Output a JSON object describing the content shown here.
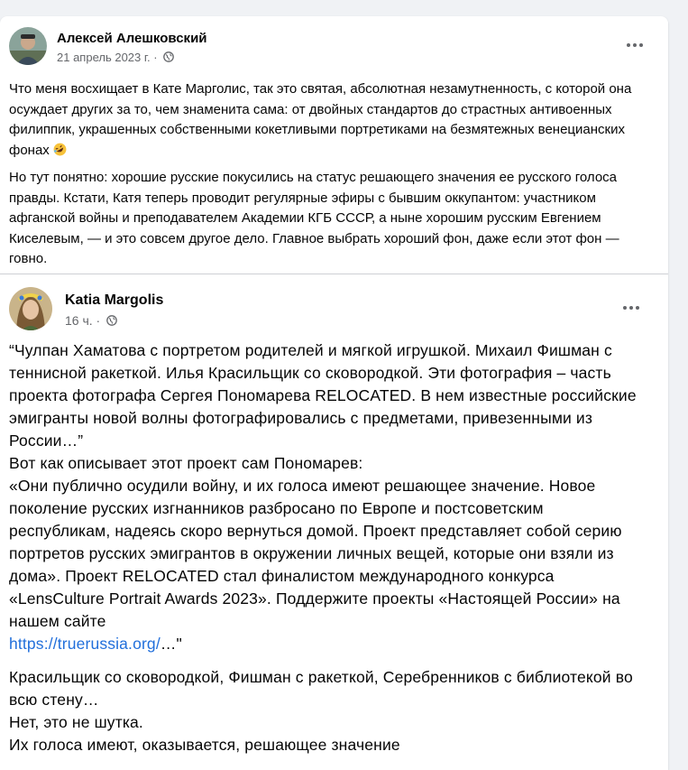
{
  "outer_post": {
    "author": "Алексей Алешковский",
    "date": "21 апрель 2023 г.",
    "separator": "·",
    "privacy_icon": "globe-icon",
    "more_icon": "more-options-icon",
    "paragraph1": "Что меня восхищает в Кате Марголис, так это святая, абсолютная незамутненность, с которой она осуждает других за то, чем знаменита сама: от двойных стандартов до страстных антивоенных филиппик, украшенных собственными кокетливыми портретиками на безмятежных венецианских фонах",
    "paragraph1_emoji": "rolling-on-floor-laughing-emoji",
    "paragraph2": "Но тут понятно: хорошие русские покусились на статус решающего значения ее русского голоса правды. Кстати, Катя теперь проводит регулярные эфиры с бывшим оккупантом: участником афганской войны и преподавателем Академии КГБ СССР, а ныне хорошим русским Евгением Киселевым, — и это совсем другое дело. Главное выбрать хороший фон, даже если этот фон — говно."
  },
  "shared_post": {
    "author": "Katia Margolis",
    "time": "16 ч.",
    "separator": "·",
    "privacy_icon": "globe-icon",
    "more_icon": "more-options-icon",
    "quote": "“Чулпан Хаматова с портретом родителей и мягкой игрушкой. Михаил Фишман с теннисной ракеткой. Илья Красильщик со сковородкой. Эти фотография – часть проекта фотографа Сергея Пономарева RELOCATED. В нем известные российские эмигранты новой волны фотографировались с предметами, привезенными из России…”\nВот как описывает этот проект сам Пономарев:\n«Они публично осудили войну, и их голоса имеют решающее значение. Новое поколение русских изгнанников разбросано по Европе и постсоветским республикам, надеясь скоро вернуться домой. Проект представляет собой серию портретов русских эмигрантов в окружении личных вещей, которые они взяли из дома». Проект RELOCATED стал финалистом международного конкурса «LensCulture Portrait Awards 2023». Поддержите проекты «Настоящей России» на нашем сайте",
    "link_text": "https://truerussia.org/",
    "link_suffix": "…\"",
    "comment": "Красильщик со сковородкой, Фишман с ракеткой, Серебренников с библиотекой во всю стену…\nНет, это не шутка.\nИх голоса имеют, оказывается, решающее значение"
  }
}
